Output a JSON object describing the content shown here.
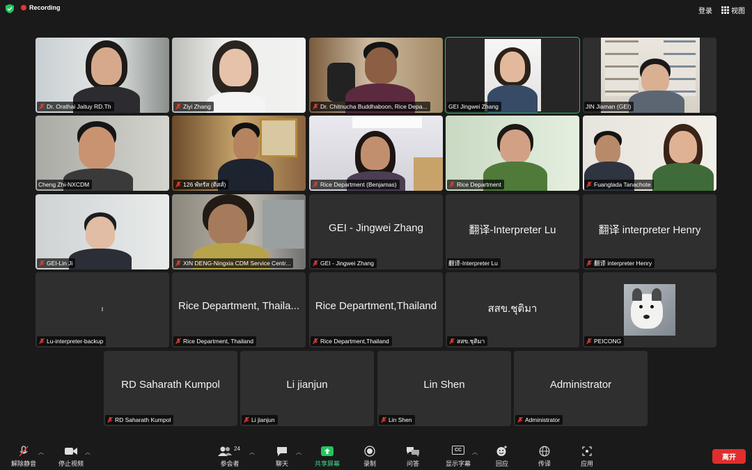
{
  "topbar": {
    "recording": "Recording",
    "login": "登录",
    "view": "视图"
  },
  "tiles": [
    {
      "name": "Dr. Orathai Jaituy RD.Th"
    },
    {
      "name": "Ziyi Zhang"
    },
    {
      "name": "Dr. Chitnucha Buddhaboon, Rice Depa..."
    },
    {
      "name": "GEI Jingwei Zhang"
    },
    {
      "name": "JIN Jiaman (GEI)"
    },
    {
      "name": "Cheng Zhi-NXCDM"
    },
    {
      "name": "126 พัทรัส (ดิสส์)"
    },
    {
      "name": "Rice Department (Benjamas)"
    },
    {
      "name": "Rice Department"
    },
    {
      "name": "Fuanglada Tanachote"
    },
    {
      "name": "GEI-Lin Ji"
    },
    {
      "name": "XIN DENG-Ningxia CDM Service Centr..."
    },
    {
      "name": "GEI - Jingwei Zhang",
      "display": "GEI - Jingwei Zhang"
    },
    {
      "name": "翻译-Interpreter Lu",
      "display": "翻译-Interpreter Lu"
    },
    {
      "name": "翻译 interpreter Henry",
      "display": "翻译 interpreter Henry"
    },
    {
      "name": "Lu-interpreter-backup"
    },
    {
      "name": "Rice Department, Thailand",
      "display": "Rice Department, Thaila..."
    },
    {
      "name": "Rice Department,Thailand",
      "display": "Rice Department,Thailand"
    },
    {
      "name": "สสข.ชุติมา",
      "display": "สสข.ชุติมา"
    },
    {
      "name": "PEICONG"
    },
    {
      "name": "RD Saharath Kumpol",
      "display": "RD Saharath Kumpol"
    },
    {
      "name": "Li jianjun",
      "display": "Li jianjun"
    },
    {
      "name": "Lin Shen",
      "display": "Lin Shen"
    },
    {
      "name": "Administrator",
      "display": "Administrator"
    }
  ],
  "toolbar": {
    "unmute": "解除静音",
    "stop_video": "停止视频",
    "participants": "参会者",
    "participant_count": "24",
    "chat": "聊天",
    "share": "共享屏幕",
    "record": "录制",
    "qa": "问答",
    "captions": "显示字幕",
    "cc": "CC",
    "reactions": "回应",
    "interpret": "传译",
    "apps": "应用",
    "leave": "离开"
  },
  "colors": {
    "active_speaker": "#22c55e",
    "leave": "#e02d2d",
    "share": "#3ddc84",
    "recording": "#e8342c"
  }
}
